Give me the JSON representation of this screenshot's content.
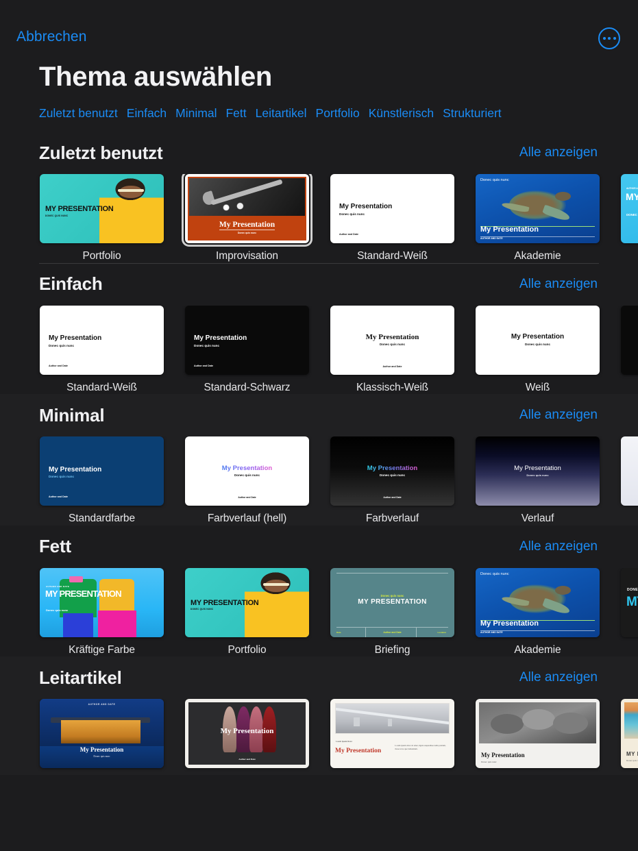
{
  "header": {
    "cancel_label": "Abbrechen",
    "title": "Thema auswählen",
    "more_icon": "more-options-icon",
    "accent_color": "#1b8cf5",
    "background_color": "#1c1c1e"
  },
  "tabs": [
    {
      "label": "Zuletzt benutzt"
    },
    {
      "label": "Einfach"
    },
    {
      "label": "Minimal"
    },
    {
      "label": "Fett"
    },
    {
      "label": "Leitartikel"
    },
    {
      "label": "Portfolio"
    },
    {
      "label": "Künstlerisch"
    },
    {
      "label": "Strukturiert"
    }
  ],
  "see_all_label": "Alle anzeigen",
  "slide_text": {
    "title": "My Presentation",
    "subtitle": "Donec quis nunc",
    "author": "Author and Date",
    "title_upper": "MY PRESENTATION",
    "subtitle_upper": "DONEC QUIS NUNC",
    "author_upper": "AUTHOR AND DATE",
    "kicker": "Lorem Ipsum Dolor",
    "body_copy": "Lorem ipsum dolor sit amet, ligula suspendisse nulla pretium, those ut ne que bamantium.",
    "footer_left": "Date",
    "footer_right": "Location"
  },
  "sections": [
    {
      "title": "Zuletzt benutzt",
      "see_all": "Alle anzeigen",
      "cards": [
        {
          "label": "Portfolio",
          "selected": false
        },
        {
          "label": "Improvisation",
          "selected": true
        },
        {
          "label": "Standard-Weiß",
          "selected": false
        },
        {
          "label": "Akademie",
          "selected": false
        },
        {
          "label": "",
          "selected": false
        }
      ]
    },
    {
      "title": "Einfach",
      "see_all": "Alle anzeigen",
      "cards": [
        {
          "label": "Standard-Weiß",
          "selected": false
        },
        {
          "label": "Standard-Schwarz",
          "selected": false
        },
        {
          "label": "Klassisch-Weiß",
          "selected": false
        },
        {
          "label": "Weiß",
          "selected": false
        },
        {
          "label": "",
          "selected": false
        }
      ]
    },
    {
      "title": "Minimal",
      "see_all": "Alle anzeigen",
      "cards": [
        {
          "label": "Standardfarbe",
          "selected": false
        },
        {
          "label": "Farbverlauf (hell)",
          "selected": false
        },
        {
          "label": "Farbverlauf",
          "selected": false
        },
        {
          "label": "Verlauf",
          "selected": false
        },
        {
          "label": "",
          "selected": false
        }
      ]
    },
    {
      "title": "Fett",
      "see_all": "Alle anzeigen",
      "cards": [
        {
          "label": "Kräftige Farbe",
          "selected": false
        },
        {
          "label": "Portfolio",
          "selected": false
        },
        {
          "label": "Briefing",
          "selected": false
        },
        {
          "label": "Akademie",
          "selected": false
        },
        {
          "label": "",
          "selected": false
        }
      ]
    },
    {
      "title": "Leitartikel",
      "see_all": "Alle anzeigen",
      "cards": [
        {
          "label": "",
          "selected": false
        },
        {
          "label": "",
          "selected": false
        },
        {
          "label": "",
          "selected": false
        },
        {
          "label": "",
          "selected": false
        },
        {
          "label": "",
          "selected": false
        }
      ]
    }
  ]
}
